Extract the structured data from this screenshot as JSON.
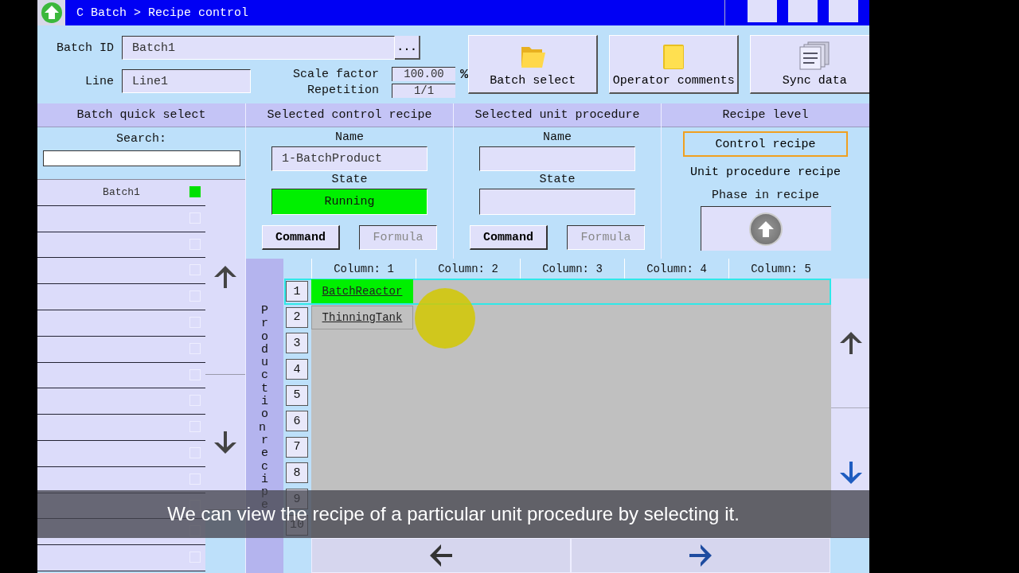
{
  "window": {
    "title": "C Batch > Recipe control"
  },
  "header": {
    "batch_id": {
      "label": "Batch ID",
      "value": "Batch1",
      "browse": "..."
    },
    "line": {
      "label": "Line",
      "value": "Line1"
    },
    "scale_factor": {
      "label": "Scale factor",
      "value": "100.00",
      "unit": "%"
    },
    "repetition": {
      "label": "Repetition",
      "value": "1/1"
    }
  },
  "actions": [
    {
      "label": "Batch select",
      "kind": "open-folder"
    },
    {
      "label": "Operator comments",
      "kind": "folder"
    },
    {
      "label": "Sync data",
      "kind": "data"
    }
  ],
  "quick_select": {
    "title": "Batch quick select",
    "search_label": "Search:",
    "items": [
      {
        "label": "Batch1",
        "active": true
      },
      {
        "active": false
      },
      {
        "active": false
      },
      {
        "active": false
      },
      {
        "active": false
      },
      {
        "active": false
      },
      {
        "active": false
      },
      {
        "active": false
      },
      {
        "active": false
      },
      {
        "active": false
      },
      {
        "active": false
      },
      {
        "active": false
      },
      {
        "active": false
      },
      {
        "active": false
      },
      {
        "active": false
      }
    ]
  },
  "control_recipe": {
    "title": "Selected control recipe",
    "name_label": "Name",
    "name": "1-BatchProduct",
    "state_label": "State",
    "state": "Running",
    "running": true,
    "command": {
      "label": "Command",
      "disabled": false
    },
    "formula": {
      "label": "Formula",
      "disabled": true
    }
  },
  "unit_procedure": {
    "title": "Selected unit procedure",
    "name_label": "Name",
    "state_label": "State",
    "running": false,
    "command": {
      "label": "Command",
      "disabled": false
    },
    "formula": {
      "label": "Formula",
      "disabled": true
    }
  },
  "recipe_level": {
    "title": "Recipe level",
    "options": [
      {
        "label": "Control recipe",
        "selected": true
      },
      {
        "label": "Unit procedure recipe",
        "selected": false
      }
    ],
    "phase_label": "Phase in recipe"
  },
  "recipe_grid": {
    "side_label": "Production recipe",
    "columns": [
      "Column: 1",
      "Column: 2",
      "Column: 3",
      "Column: 4",
      "Column: 5"
    ],
    "rows": [
      {
        "number": "1",
        "selected": true,
        "cell": {
          "text": "BatchReactor",
          "active": true
        }
      },
      {
        "number": "2",
        "selected": false,
        "cell": {
          "text": "ThinningTank",
          "active": false
        }
      },
      {
        "number": "3",
        "selected": false
      },
      {
        "number": "4",
        "selected": false
      },
      {
        "number": "5",
        "selected": false
      },
      {
        "number": "6",
        "selected": false
      },
      {
        "number": "7",
        "selected": false
      },
      {
        "number": "8",
        "selected": false
      },
      {
        "number": "9",
        "selected": false
      },
      {
        "number": "10",
        "selected": false
      }
    ]
  },
  "caption": "We can view the recipe of a particular unit procedure by selecting it."
}
